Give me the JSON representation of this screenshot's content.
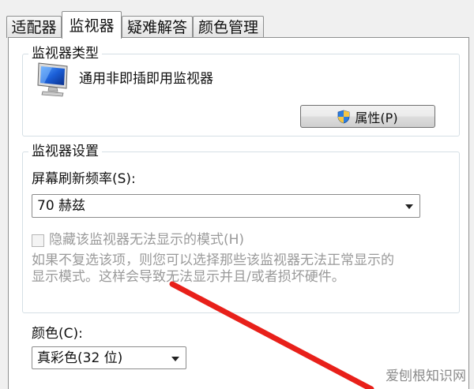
{
  "tabs": [
    {
      "label": "适配器",
      "active": false
    },
    {
      "label": "监视器",
      "active": true
    },
    {
      "label": "疑难解答",
      "active": false
    },
    {
      "label": "颜色管理",
      "active": false
    }
  ],
  "monitor_type": {
    "legend": "监视器类型",
    "device_name": "通用非即插即用监视器",
    "device_icon": "monitor-icon",
    "properties_button": "属性(P)",
    "shield_icon": "uac-shield-icon"
  },
  "monitor_settings": {
    "legend": "监视器设置",
    "refresh_label": "屏幕刷新频率(S):",
    "refresh_value": "70 赫兹",
    "hide_modes_checkbox": "隐藏该监视器无法显示的模式(H)",
    "hide_modes_checked": false,
    "description_line1": "如果不复选该项，则您可以选择那些该监视器无法正常显示的",
    "description_line2": "显示模式。这样会导致无法显示并且/或者损坏硬件。"
  },
  "colors": {
    "label": "颜色(C):",
    "value": "真彩色(32 位)"
  },
  "watermark": "爱刨根知识网",
  "annotation_color": "#e8201a"
}
